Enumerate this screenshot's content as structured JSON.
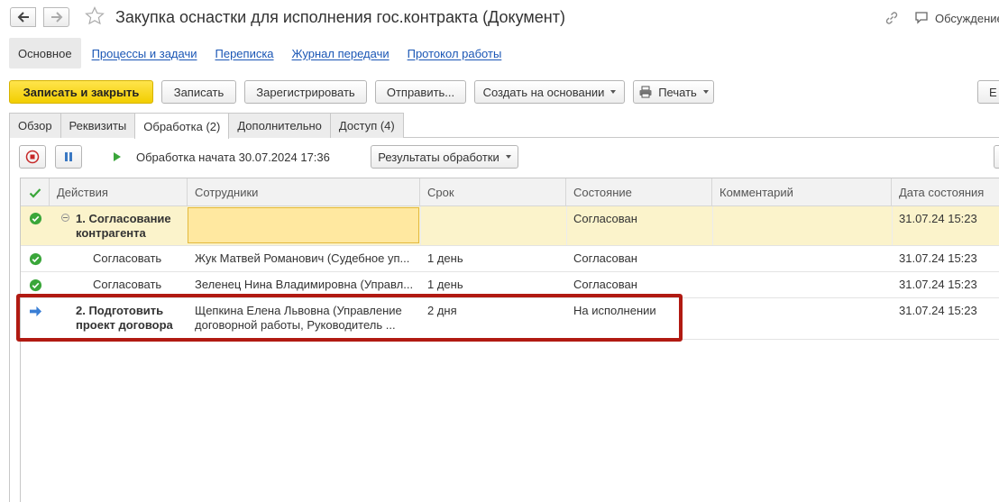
{
  "window": {
    "title": "Закупка оснастки для исполнения гос.контракта (Документ)",
    "discuss_label": "Обсуждение"
  },
  "sections": {
    "active": "Основное",
    "links": [
      "Процессы и задачи",
      "Переписка",
      "Журнал передачи",
      "Протокол работы"
    ]
  },
  "toolbar": {
    "save_close": "Записать и закрыть",
    "save": "Записать",
    "register": "Зарегистрировать",
    "send": "Отправить...",
    "create_based": "Создать на основании",
    "print": "Печать",
    "more_partial": "Е"
  },
  "tabs": [
    {
      "label": "Обзор",
      "active": false
    },
    {
      "label": "Реквизиты",
      "active": false
    },
    {
      "label": "Обработка (2)",
      "active": true
    },
    {
      "label": "Дополнительно",
      "active": false
    },
    {
      "label": "Доступ (4)",
      "active": false
    }
  ],
  "processing": {
    "status": "Обработка начата 30.07.2024 17:36",
    "results_button": "Результаты обработки"
  },
  "grid": {
    "columns": [
      "Действия",
      "Сотрудники",
      "Срок",
      "Состояние",
      "Комментарий",
      "Дата состояния"
    ],
    "rows": [
      {
        "icon": "check",
        "action": "1. Согласование контрагента",
        "employees": "",
        "term": "",
        "state": "Согласован",
        "comment": "",
        "date": "31.07.24 15:23",
        "bold": true,
        "group": true
      },
      {
        "icon": "check",
        "action": "Согласовать",
        "employees": "Жук Матвей Романович (Судебное уп...",
        "term": "1 день",
        "state": "Согласован",
        "comment": "",
        "date": "31.07.24 15:23",
        "bold": false,
        "group": false
      },
      {
        "icon": "check",
        "action": "Согласовать",
        "employees": "Зеленец Нина Владимировна (Управл...",
        "term": "1 день",
        "state": "Согласован",
        "comment": "",
        "date": "31.07.24 15:23",
        "bold": false,
        "group": false
      },
      {
        "icon": "arrow",
        "action": "2. Подготовить проект договора",
        "employees": "Щепкина Елена Львовна (Управление договорной работы, Руководитель ...",
        "term": "2 дня",
        "state": "На исполнении",
        "comment": "",
        "date": "31.07.24 15:23",
        "bold": true,
        "group": false
      }
    ]
  },
  "colors": {
    "accent_link": "#1a56b5",
    "primary_button": "#f2ce00",
    "selected_row": "#fbf3cb",
    "highlight_frame": "#b11a12",
    "check_green": "#3aa63a",
    "arrow_blue": "#3a7fd5"
  }
}
